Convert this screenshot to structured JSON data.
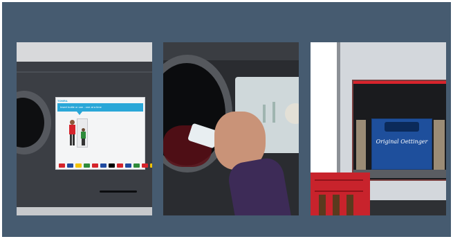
{
  "photos": [
    {
      "id": "panel-1",
      "subject": "reverse-vending-machine-touchscreen",
      "screen_text": "Insert bottle or can - one at a time",
      "brand_text": "TOMRA",
      "flag_colors": [
        "#d5232b",
        "#1f4aa0",
        "#f3c300",
        "#2e8b3a",
        "#d5232b",
        "#1f4aa0",
        "#000000",
        "#d5232b",
        "#1f4aa0",
        "#2e8b3a",
        "#d5232b",
        "#f3c300"
      ]
    },
    {
      "id": "panel-2",
      "subject": "hand-inserting-bottle"
    },
    {
      "id": "panel-3",
      "subject": "crate-return-compartment",
      "crate_text": "Original Oettinger"
    }
  ],
  "colors": {
    "frame": "#465b70",
    "screen_header": "#2aa7d8",
    "red_crate": "#c8232c",
    "blue_crate": "#1e4f9c"
  }
}
